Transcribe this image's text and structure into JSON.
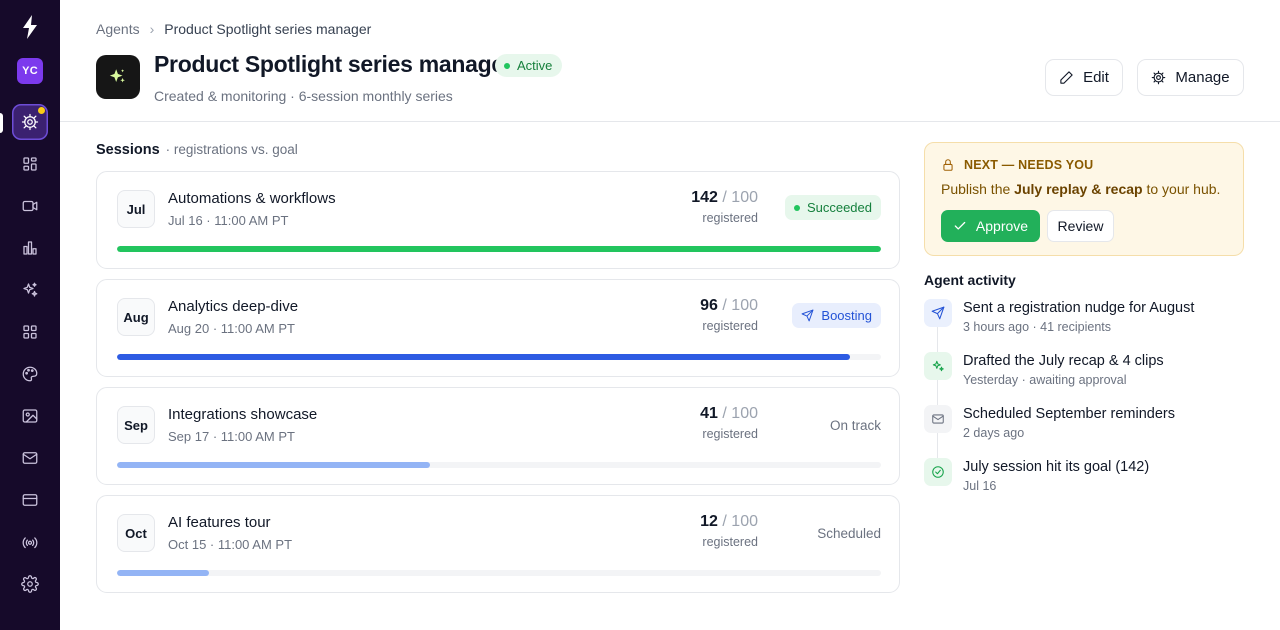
{
  "sidebar": {
    "avatar_initials": "YC",
    "items": [
      {
        "name": "agents",
        "icon": "gear-sparkle-icon",
        "active": true,
        "has_notification": true
      },
      {
        "name": "dashboard",
        "icon": "grid-icon"
      },
      {
        "name": "video",
        "icon": "video-icon"
      },
      {
        "name": "analytics",
        "icon": "bar-chart-icon"
      },
      {
        "name": "ai",
        "icon": "sparkles-icon"
      },
      {
        "name": "apps",
        "icon": "apps-icon"
      },
      {
        "name": "branding",
        "icon": "palette-icon"
      },
      {
        "name": "media",
        "icon": "image-icon"
      },
      {
        "name": "email",
        "icon": "mail-icon"
      },
      {
        "name": "billing",
        "icon": "card-icon"
      },
      {
        "name": "broadcast",
        "icon": "broadcast-icon"
      },
      {
        "name": "settings",
        "icon": "settings-icon"
      }
    ]
  },
  "breadcrumb": {
    "parent": "Agents",
    "current": "Product Spotlight series manager"
  },
  "header": {
    "title": "Product Spotlight series manager",
    "status": "Active",
    "subtitle": "Created & monitoring · 6-session monthly series",
    "edit_label": "Edit",
    "manage_label": "Manage"
  },
  "sessions": {
    "heading": "Sessions",
    "subheading": "· registrations vs. goal",
    "registered_label": "registered",
    "items": [
      {
        "month": "Jul",
        "name": "Automations & workflows",
        "date": "Jul 16 · 11:00 AM PT",
        "registered": "142",
        "goal": "/ 100",
        "status": "Succeeded",
        "status_style": "succeeded",
        "progress": 1.0,
        "bar_color": "#22c55e"
      },
      {
        "month": "Aug",
        "name": "Analytics deep-dive",
        "date": "Aug 20 · 11:00 AM PT",
        "registered": "96",
        "goal": "/ 100",
        "status": "Boosting",
        "status_style": "boosting",
        "progress": 0.96,
        "bar_color": "#2d5be3"
      },
      {
        "month": "Sep",
        "name": "Integrations showcase",
        "date": "Sep 17 · 11:00 AM PT",
        "registered": "41",
        "goal": "/ 100",
        "status": "On track",
        "status_style": "plain",
        "progress": 0.41,
        "bar_color": "#93b4f5"
      },
      {
        "month": "Oct",
        "name": "AI features tour",
        "date": "Oct 15 · 11:00 AM PT",
        "registered": "12",
        "goal": "/ 100",
        "status": "Scheduled",
        "status_style": "plain",
        "progress": 0.12,
        "bar_color": "#93b4f5"
      }
    ]
  },
  "next": {
    "heading": "NEXT — NEEDS YOU",
    "text_before": "Publish the ",
    "text_bold": "July replay & recap",
    "text_after": " to your hub.",
    "approve_label": "Approve",
    "review_label": "Review"
  },
  "activity": {
    "heading": "Agent activity",
    "items": [
      {
        "icon": "send-icon",
        "style": "blue",
        "title": "Sent a registration nudge for August",
        "meta": "3 hours ago · 41 recipients"
      },
      {
        "icon": "sparkles-icon",
        "style": "green",
        "title": "Drafted the July recap & 4 clips",
        "meta": "Yesterday · awaiting approval"
      },
      {
        "icon": "mail-icon",
        "style": "gray",
        "title": "Scheduled September reminders",
        "meta": "2 days ago"
      },
      {
        "icon": "check-circle-icon",
        "style": "green",
        "title": "July session hit its goal (142)",
        "meta": "Jul 16"
      }
    ]
  }
}
